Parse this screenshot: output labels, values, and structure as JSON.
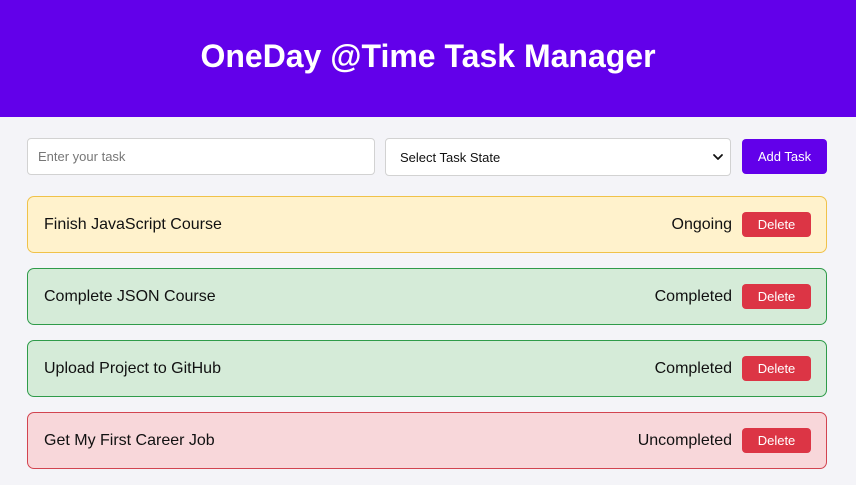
{
  "header": {
    "title": "OneDay @Time Task Manager"
  },
  "form": {
    "input_placeholder": "Enter your task",
    "input_value": "",
    "select_value": "Select Task State",
    "add_label": "Add Task"
  },
  "tasks": [
    {
      "name": "Finish JavaScript Course",
      "state": "Ongoing",
      "delete_label": "Delete"
    },
    {
      "name": "Complete JSON Course",
      "state": "Completed",
      "delete_label": "Delete"
    },
    {
      "name": "Upload Project to GitHub",
      "state": "Completed",
      "delete_label": "Delete"
    },
    {
      "name": "Get My First Career Job",
      "state": "Uncompleted",
      "delete_label": "Delete"
    }
  ],
  "colors": {
    "accent": "#6200ea",
    "delete": "#dc3545",
    "ongoing_bg": "#fff2cc",
    "completed_bg": "#d5ebd8",
    "uncompleted_bg": "#f8d7da"
  },
  "icons": {
    "select_arrow": "chevron-down-icon"
  }
}
